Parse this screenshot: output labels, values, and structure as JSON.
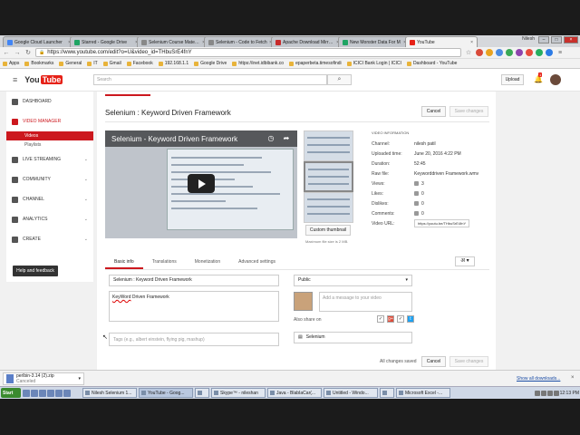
{
  "browser": {
    "tabs": [
      {
        "title": "Google Cloud Launcher",
        "color": "#4285f4"
      },
      {
        "title": "Starred - Google Drive",
        "color": "#1fa463"
      },
      {
        "title": "Selenium Course Materials",
        "color": "#888888"
      },
      {
        "title": "Selenium - Code to Fetch",
        "color": "#888888"
      },
      {
        "title": "Apache Download Mirrors",
        "color": "#c72a2a"
      },
      {
        "title": "New Monster Data For M",
        "color": "#1fa463"
      },
      {
        "title": "YouTube",
        "color": "#e62117"
      }
    ],
    "user_name": "Nilesh",
    "url": "https://www.youtube.com/edit?o=U&video_id=THbuSrE4fnY",
    "bookmarks": [
      "Apps",
      "Bookmarks",
      "General",
      "IT",
      "Gmail",
      "Facebook",
      "192.168.1.1",
      "Google Drive",
      "https://inet.idbibank.co",
      "epaperbeta.timesofindi",
      "ICICI Bank Login | ICICI",
      "Dashboard - YouTube"
    ]
  },
  "yt": {
    "logo_you": "You",
    "logo_tube": "Tube",
    "search_placeholder": "Search",
    "upload": "Upload",
    "notification_count": "1"
  },
  "sidebar": {
    "items": [
      {
        "label": "Dashboard"
      },
      {
        "label": "Video Manager"
      },
      {
        "label": "Live Streaming"
      },
      {
        "label": "Community"
      },
      {
        "label": "Channel"
      },
      {
        "label": "Analytics"
      },
      {
        "label": "Create"
      }
    ],
    "sub": [
      "Videos",
      "Playlists"
    ],
    "help": "Help and feedback"
  },
  "video": {
    "title": "Selenium : Keyword Driven Framework",
    "cancel": "Cancel",
    "save": "Save changes",
    "player_title": "Selenium - Keyword Driven Framework",
    "custom_thumb": "Custom thumbnail",
    "thumb_note": "Maximum file size is 2 MB.",
    "info": {
      "heading": "VIDEO INFORMATION",
      "channel_k": "Channel:",
      "channel_v": "nilesh patil",
      "uploaded_k": "Uploaded time:",
      "uploaded_v": "June 20, 2016 4:22 PM",
      "duration_k": "Duration:",
      "duration_v": "52:45",
      "raw_k": "Raw file:",
      "raw_v": "Keyworddriven Framework.wmv",
      "views_k": "Views:",
      "views_v": "3",
      "likes_k": "Likes:",
      "likes_v": "0",
      "dislikes_k": "Dislikes:",
      "dislikes_v": "0",
      "comments_k": "Comments:",
      "comments_v": "0",
      "url_k": "Video URL:",
      "url_v": "https://youtu.be/THbuSrE4fnY"
    }
  },
  "edit": {
    "tabs": [
      "Basic info",
      "Translations",
      "Monetization",
      "Advanced settings"
    ],
    "lang_symbol": "अ",
    "title_value": "Selenium : Keyword Driven  Framework",
    "desc_kw": "KeyWord",
    "desc_rest": " Driven Framework",
    "tags_placeholder": "Tags (e.g., albert einstein, flying pig, mashup)",
    "visibility": "Public",
    "comment_placeholder": "Add a message to your video",
    "also_share": "Also share on",
    "playlist": "Selenium",
    "saved_status": "All changes saved",
    "cancel": "Cancel",
    "save": "Save changes"
  },
  "downloads": {
    "file": "perlbin-3.14 (2).zip",
    "status": "Canceled",
    "show_all": "Show all downloads..."
  },
  "taskbar": {
    "start": "Start",
    "tasks": [
      "Nilesh Selenium 1...",
      "YouTube - Goog...",
      "",
      "Skype™ - nileshan",
      "Java - BlabIaCar(...",
      "Untitled - Windo...",
      "",
      "Microsoft Excel -..."
    ],
    "clock": "12:13 PM"
  }
}
